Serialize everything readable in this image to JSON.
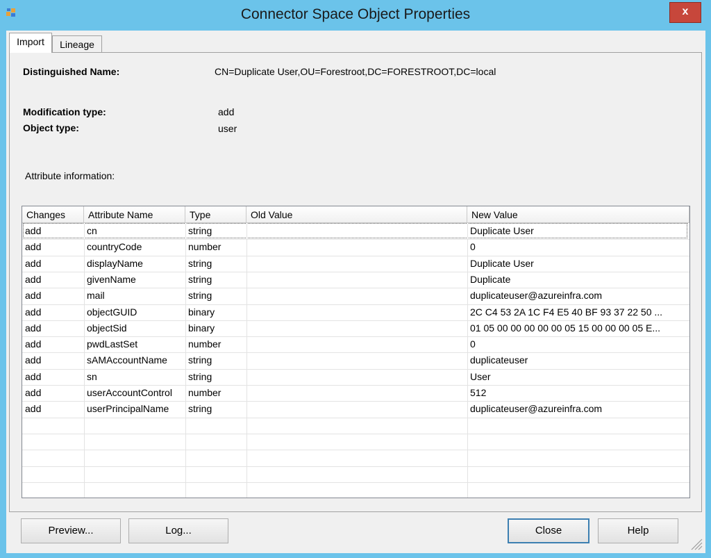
{
  "window": {
    "title": "Connector Space Object Properties",
    "close_glyph": "x"
  },
  "tabs": [
    {
      "label": "Import",
      "active": true
    },
    {
      "label": "Lineage",
      "active": false
    }
  ],
  "object": {
    "dn_label": "Distinguished Name:",
    "dn_value": "CN=Duplicate User,OU=Forestroot,DC=FORESTROOT,DC=local",
    "modtype_label": "Modification type:",
    "modtype_value": "add",
    "objtype_label": "Object type:",
    "objtype_value": "user"
  },
  "attributes": {
    "section_label": "Attribute information:",
    "columns": [
      "Changes",
      "Attribute Name",
      "Type",
      "Old Value",
      "New Value"
    ],
    "rows": [
      [
        "add",
        "cn",
        "string",
        "",
        "Duplicate User"
      ],
      [
        "add",
        "countryCode",
        "number",
        "",
        "0"
      ],
      [
        "add",
        "displayName",
        "string",
        "",
        "Duplicate User"
      ],
      [
        "add",
        "givenName",
        "string",
        "",
        "Duplicate"
      ],
      [
        "add",
        "mail",
        "string",
        "",
        "duplicateuser@azureinfra.com"
      ],
      [
        "add",
        "objectGUID",
        "binary",
        "",
        "2C C4 53 2A 1C F4 E5 40 BF 93 37 22 50 ..."
      ],
      [
        "add",
        "objectSid",
        "binary",
        "",
        "01 05 00 00 00 00 00 05 15 00 00 00 05 E..."
      ],
      [
        "add",
        "pwdLastSet",
        "number",
        "",
        "0"
      ],
      [
        "add",
        "sAMAccountName",
        "string",
        "",
        "duplicateuser"
      ],
      [
        "add",
        "sn",
        "string",
        "",
        "User"
      ],
      [
        "add",
        "userAccountControl",
        "number",
        "",
        "512"
      ],
      [
        "add",
        "userPrincipalName",
        "string",
        "",
        "duplicateuser@azureinfra.com"
      ]
    ]
  },
  "buttons": {
    "preview": "Preview...",
    "log": "Log...",
    "close": "Close",
    "help": "Help"
  },
  "colors": {
    "title_bar": "#6bc3ea",
    "close_button": "#c7473b",
    "dialog_bg": "#f0f0f0",
    "default_button_border": "#3c7fb1"
  },
  "icons": [
    "app-icon",
    "close-icon",
    "resize-grip-icon"
  ]
}
